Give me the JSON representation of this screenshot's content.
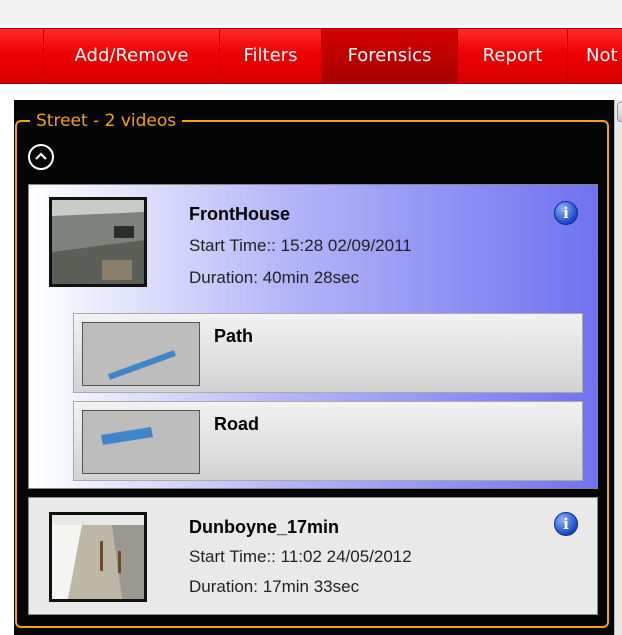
{
  "menu": {
    "items": [
      {
        "label": ""
      },
      {
        "label": "Add/Remove"
      },
      {
        "label": "Filters"
      },
      {
        "label": "Forensics",
        "active": true
      },
      {
        "label": "Report"
      },
      {
        "label": "Not"
      }
    ]
  },
  "group": {
    "title": "Street - 2 videos"
  },
  "videos": [
    {
      "name": "FrontHouse",
      "start": "Start Time:: 15:28 02/09/2011",
      "duration": "Duration: 40min 28sec",
      "sub_items": [
        {
          "label": "Path"
        },
        {
          "label": "Road"
        }
      ]
    },
    {
      "name": "Dunboyne_17min",
      "start": "Start Time:: 11:02 24/05/2012",
      "duration": "Duration: 17min 33sec"
    }
  ],
  "icons": {
    "info": "info-icon",
    "collapse": "chevron-up-icon"
  },
  "colors": {
    "menu_red": "#ee0000",
    "group_border": "#f0a21a",
    "selected_gradient_end": "#6f72f0"
  }
}
